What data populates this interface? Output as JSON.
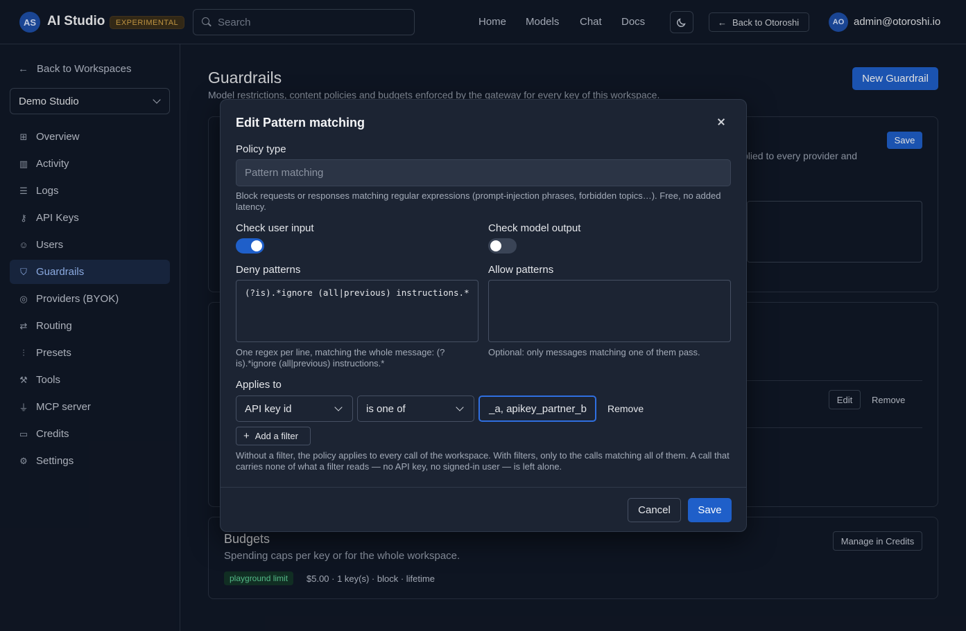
{
  "header": {
    "logo_initials": "AS",
    "app_title": "AI Studio",
    "badge": "EXPERIMENTAL",
    "search_placeholder": "Search",
    "nav": [
      "Home",
      "Models",
      "Chat",
      "Docs"
    ],
    "back_label": "Back to Otoroshi",
    "user_initials": "AO",
    "user_email": "admin@otoroshi.io"
  },
  "sidebar": {
    "back_label": "Back to Workspaces",
    "workspace": "Demo Studio",
    "items": [
      {
        "label": "Overview",
        "icon": "grid-icon"
      },
      {
        "label": "Activity",
        "icon": "bar-chart-icon"
      },
      {
        "label": "Logs",
        "icon": "list-icon"
      },
      {
        "label": "API Keys",
        "icon": "key-icon"
      },
      {
        "label": "Users",
        "icon": "users-icon"
      },
      {
        "label": "Guardrails",
        "icon": "shield-icon",
        "active": true
      },
      {
        "label": "Providers (BYOK)",
        "icon": "database-icon"
      },
      {
        "label": "Routing",
        "icon": "route-icon"
      },
      {
        "label": "Presets",
        "icon": "sliders-icon"
      },
      {
        "label": "Tools",
        "icon": "wrench-icon"
      },
      {
        "label": "MCP server",
        "icon": "plug-icon"
      },
      {
        "label": "Credits",
        "icon": "card-icon"
      },
      {
        "label": "Settings",
        "icon": "gear-icon"
      }
    ]
  },
  "page": {
    "title": "Guardrails",
    "subtitle": "Model restrictions, content policies and budgets enforced by the gateway for every key of this workspace.",
    "new_button": "New Guardrail",
    "card1_save": "Save",
    "card1_text": "plied to every provider and",
    "card2_edit": "Edit",
    "card2_remove": "Remove",
    "budgets": {
      "title": "Budgets",
      "subtitle": "Spending caps per key or for the whole workspace.",
      "manage": "Manage in Credits",
      "badge": "playground limit",
      "detail": "$5.00 · 1 key(s) · block · lifetime"
    }
  },
  "modal": {
    "title": "Edit Pattern matching",
    "policy_type_label": "Policy type",
    "policy_type_value": "Pattern matching",
    "policy_help": "Block requests or responses matching regular expressions (prompt-injection phrases, forbidden topics…). Free, no added latency.",
    "check_input_label": "Check user input",
    "check_input_on": true,
    "check_output_label": "Check model output",
    "check_output_on": false,
    "deny_label": "Deny patterns",
    "deny_value": "(?is).*ignore (all|previous) instructions.*",
    "deny_help": "One regex per line, matching the whole message: (?is).*ignore (all|previous) instructions.*",
    "allow_label": "Allow patterns",
    "allow_value": "",
    "allow_help": "Optional: only messages matching one of them pass.",
    "applies_label": "Applies to",
    "filter_field": "API key id",
    "filter_op": "is one of",
    "filter_value": "_a, apikey_partner_b",
    "remove_label": "Remove",
    "add_filter_label": "Add a filter",
    "filter_help": "Without a filter, the policy applies to every call of the workspace. With filters, only to the calls matching all of them. A call that carries none of what a filter reads — no API key, no signed-in user — is left alone.",
    "cancel_label": "Cancel",
    "save_label": "Save"
  }
}
